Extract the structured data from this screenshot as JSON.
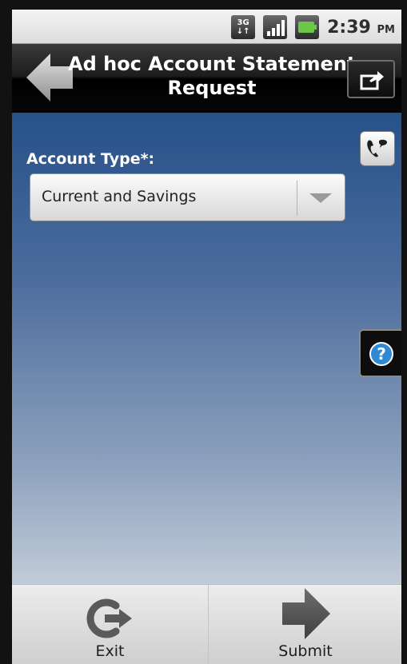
{
  "status_bar": {
    "network_icon": "3g-icon",
    "network_label_top": "3G",
    "network_label_bottom": "↓↑",
    "signal_icon": "signal-strength-icon",
    "battery_icon": "battery-icon",
    "time": "2:39",
    "ampm": "PM"
  },
  "header": {
    "back_icon": "back-arrow-icon",
    "title_line1": "Ad hoc Account Statement",
    "title_line2": "Request",
    "share_icon": "share-icon"
  },
  "form": {
    "account_type_label": "Account Type*:",
    "account_type_value": "Current and Savings",
    "dropdown_icon": "chevron-down-icon",
    "contact_icon": "contact-support-icon",
    "help_icon": "help-icon",
    "help_glyph": "?"
  },
  "footer": {
    "exit_label": "Exit",
    "exit_icon": "exit-icon",
    "submit_label": "Submit",
    "submit_icon": "arrow-right-icon"
  },
  "colors": {
    "header_bg": "#000000",
    "content_top": "#26518a",
    "content_bottom": "#c2cbd8",
    "help_accent": "#2f8ad6"
  }
}
